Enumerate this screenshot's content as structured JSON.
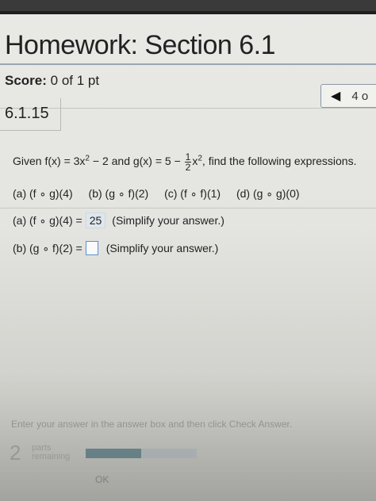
{
  "header": {
    "title": "Homework: Section 6.1",
    "score_label": "Score:",
    "score_value": "0 of 1 pt"
  },
  "nav": {
    "prev_icon": "triangle-left-icon",
    "position": "4 o"
  },
  "question": {
    "number": "6.1.15",
    "given_prefix": "Given f(x) = 3x",
    "sq": "2",
    "given_mid": " − 2 and g(x) = 5 − ",
    "frac_num": "1",
    "frac_den": "2",
    "given_x": "x",
    "sq2": "2",
    "given_suffix": ", find the following expressions.",
    "parts": [
      "(a)  (f ∘ g)(4)",
      "(b)  (g ∘ f)(2)",
      "(c)  (f ∘ f)(1)",
      "(d)  (g ∘ g)(0)"
    ]
  },
  "answers": {
    "a_label": "(a) (f ∘ g)(4) =",
    "a_value": "25",
    "a_hint": "(Simplify your answer.)",
    "b_label": "(b) (g ∘ f)(2) =",
    "b_value": "",
    "b_hint": "(Simplify your answer.)"
  },
  "footer": {
    "instruction": "Enter your answer in the answer box and then click Check Answer.",
    "parts_count": "2",
    "parts_word": "parts",
    "remaining_word": "remaining",
    "progress_fraction": 0.5,
    "ok_label": "OK"
  },
  "colors": {
    "answer_highlight": "#dfe6ee",
    "input_border": "#5a8fd0",
    "progress_fill": "#6f8b92"
  }
}
